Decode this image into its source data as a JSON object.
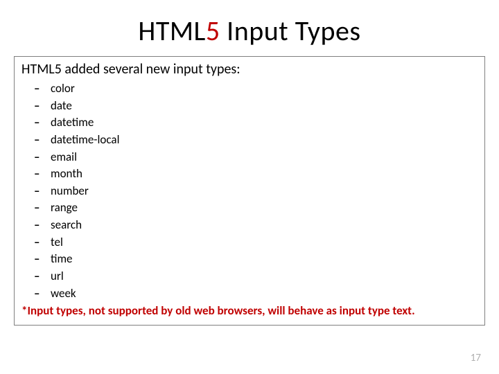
{
  "title": {
    "part1": "HTML",
    "accent1": "5",
    "part2": " Input Types"
  },
  "intro": {
    "part1": "HTML",
    "accent1": "5",
    "part2": " added several new input types:"
  },
  "types": [
    "color",
    "date",
    "datetime",
    "datetime-local",
    "email",
    "month",
    "number",
    "range",
    "search",
    "tel",
    "time",
    "url",
    "week"
  ],
  "note": "*Input types, not supported by old web browsers, will behave as input type text.",
  "page_number": "17"
}
